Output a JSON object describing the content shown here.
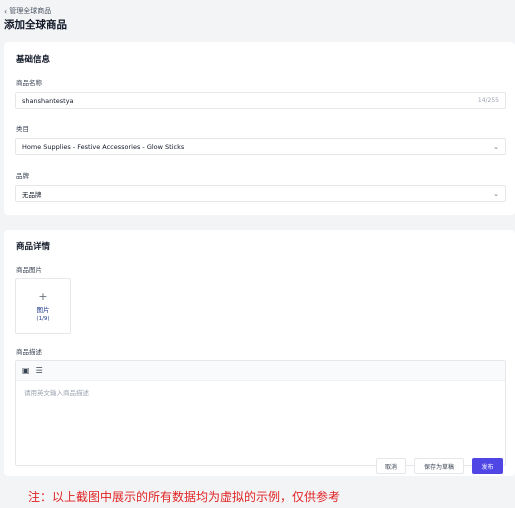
{
  "breadcrumb": {
    "back_label": "管理全球商品"
  },
  "page_title": "添加全球商品",
  "basic_info": {
    "title": "基础信息",
    "name_label": "商品名称",
    "name_value": "shanshantestya",
    "name_counter": "14/255",
    "category_label": "类目",
    "category_value": "Home Supplies - Festive Accessories - Glow Sticks",
    "brand_label": "品牌",
    "brand_value": "无品牌"
  },
  "details": {
    "title": "商品详情",
    "images_label": "商品图片",
    "upload_label": "图片",
    "upload_count": "(1/9)",
    "description_label": "商品描述",
    "description_placeholder": "请用英文输入商品描述"
  },
  "actions": {
    "cancel": "取消",
    "save_draft": "保存为草稿",
    "publish": "发布"
  },
  "note": "注：以上截图中展示的所有数据均为虚拟的示例，仅供参考",
  "colors": {
    "accent": "#4f46e5",
    "note": "#e02424"
  }
}
